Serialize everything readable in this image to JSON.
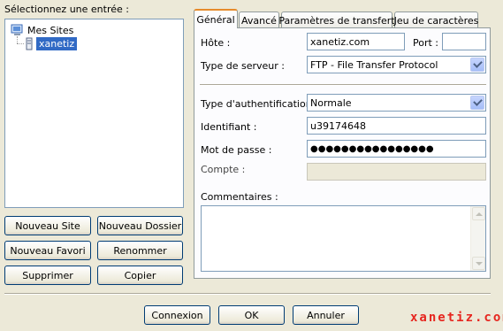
{
  "left_panel": {
    "select_label": "Sélectionnez une entrée :",
    "tree": {
      "root": "Mes Sites",
      "selected_site": "xanetiz"
    },
    "buttons": {
      "new_site": "Nouveau Site",
      "new_folder": "Nouveau Dossier",
      "new_favorite": "Nouveau Favori",
      "rename": "Renommer",
      "delete": "Supprimer",
      "copy": "Copier"
    }
  },
  "tabs": [
    "Général",
    "Avancé",
    "Paramètres de transfert",
    "Jeu de caractères"
  ],
  "general": {
    "host_label": "Hôte :",
    "host_value": "xanetiz.com",
    "port_label": "Port :",
    "port_value": "",
    "server_type_label": "Type de serveur :",
    "server_type_value": "FTP - File Transfer Protocol",
    "auth_type_label": "Type d'authentification :",
    "auth_type_value": "Normale",
    "user_label": "Identifiant :",
    "user_value": "u39174648",
    "password_label": "Mot de passe :",
    "password_value": "●●●●●●●●●●●●●●●●",
    "account_label": "Compte :",
    "account_value": "",
    "comments_label": "Commentaires :"
  },
  "footer_buttons": {
    "connect": "Connexion",
    "ok": "OK",
    "cancel": "Annuler"
  },
  "watermark": "xanetiz.com",
  "colors": {
    "selection": "#316ac5",
    "active_tab_accent": "#e68b2c",
    "watermark": "#e6261f"
  }
}
